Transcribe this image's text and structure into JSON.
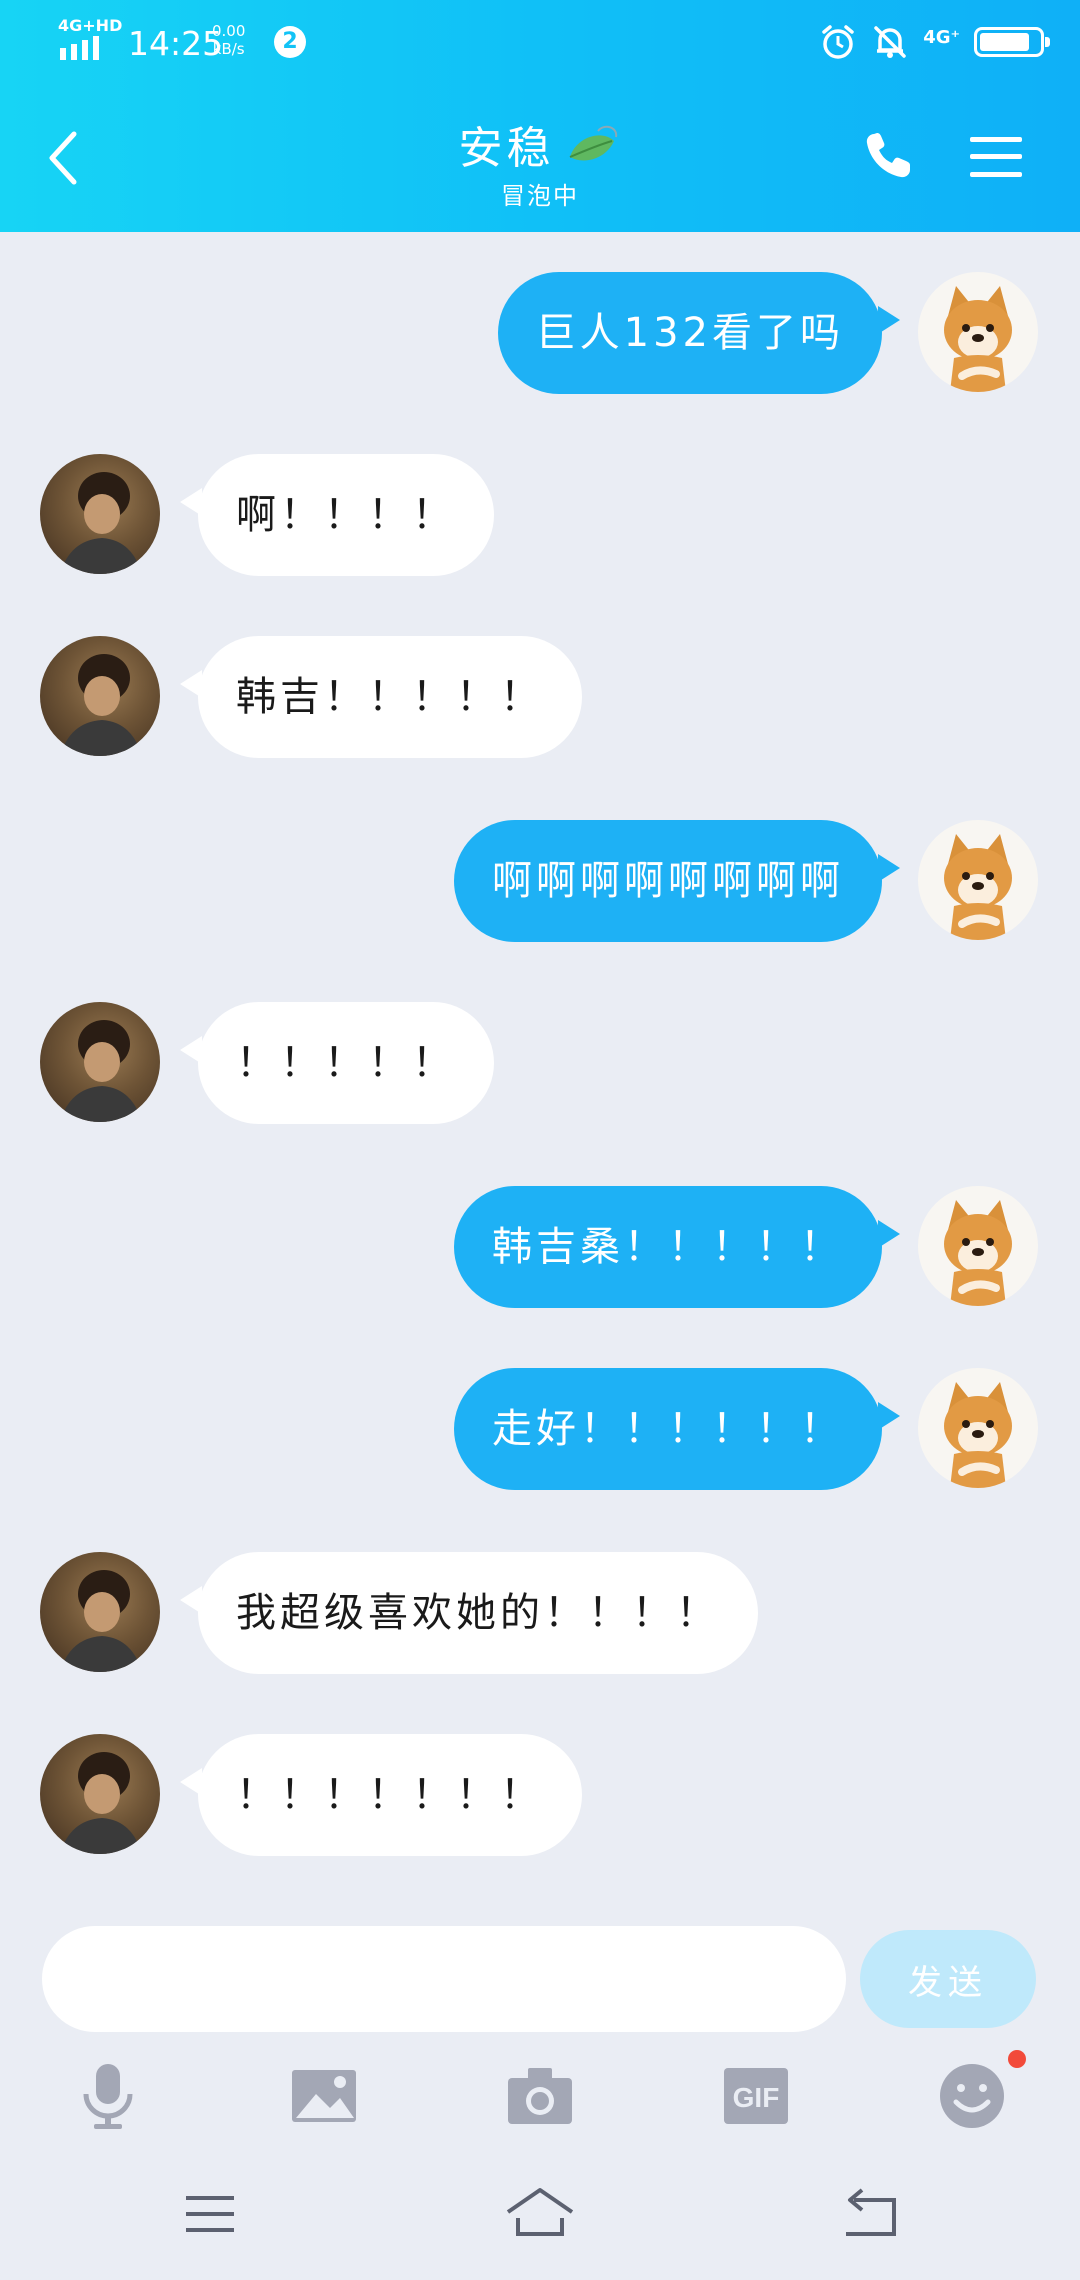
{
  "status_bar": {
    "network": "4G+HD",
    "time": "14:25",
    "speed_value": "0.00",
    "speed_unit": "kB/s",
    "notification_count": "2",
    "signal_right": "4G⁺",
    "battery_level": 0.85,
    "icons": [
      "signal-icon",
      "alarm-icon",
      "mute-icon",
      "battery-icon"
    ]
  },
  "header": {
    "title": "安稳",
    "subtitle": "冒泡中",
    "icons": [
      "back-icon",
      "leaf-icon",
      "phone-icon",
      "menu-icon"
    ]
  },
  "messages": [
    {
      "side": "right",
      "text": "巨人132看了吗"
    },
    {
      "side": "left",
      "text": "啊！！！！"
    },
    {
      "side": "left",
      "text": "韩吉！！！！！"
    },
    {
      "side": "right",
      "text": "啊啊啊啊啊啊啊啊"
    },
    {
      "side": "left",
      "text": "！！！！！"
    },
    {
      "side": "right",
      "text": "韩吉桑！！！！！"
    },
    {
      "side": "right",
      "text": "走好！！！！！！"
    },
    {
      "side": "left",
      "text": "我超级喜欢她的！！！！"
    },
    {
      "side": "left",
      "text": "！！！！！！！"
    }
  ],
  "input": {
    "value": "",
    "placeholder": "",
    "send_label": "发送"
  },
  "toolbar": {
    "items": [
      "microphone-icon",
      "image-icon",
      "camera-icon",
      "gif-icon",
      "emoji-icon"
    ],
    "gif_label": "GIF",
    "emoji_has_badge": true
  },
  "colors": {
    "header_start": "#17d4f5",
    "header_end": "#0fb0f7",
    "bubble_sent": "#1eb1f5",
    "bubble_received": "#ffffff",
    "background": "#eaedf4",
    "send_button": "#bfe9fb",
    "icon_gray": "#a3a7b5",
    "badge_red": "#f24a3a"
  },
  "navigation": {
    "items": [
      "nav-menu-icon",
      "nav-home-icon",
      "nav-back-icon"
    ]
  }
}
